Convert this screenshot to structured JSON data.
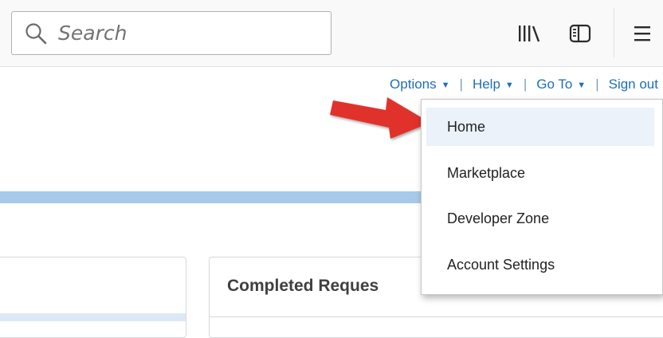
{
  "browser": {
    "search": {
      "placeholder": "Search",
      "value": ""
    },
    "icons": [
      "search-icon",
      "library-icon",
      "sidebar-icon",
      "hamburger-menu-icon"
    ]
  },
  "header_links": [
    {
      "label": "Options",
      "has_caret": true
    },
    {
      "label": "Help",
      "has_caret": true
    },
    {
      "label": "Go To",
      "has_caret": true
    },
    {
      "label": "Sign out",
      "has_caret": false
    }
  ],
  "go_to_menu": {
    "items": [
      {
        "label": "Home",
        "highlighted": true
      },
      {
        "label": "Marketplace",
        "highlighted": false
      },
      {
        "label": "Developer Zone",
        "highlighted": false
      },
      {
        "label": "Account Settings",
        "highlighted": false
      }
    ]
  },
  "panels": {
    "right_title": "Completed Reques"
  },
  "colors": {
    "link": "#1f6fb5",
    "bluebar": "#a7c9ea",
    "highlight": "#ebf2fa",
    "arrow": "#e0302b"
  }
}
